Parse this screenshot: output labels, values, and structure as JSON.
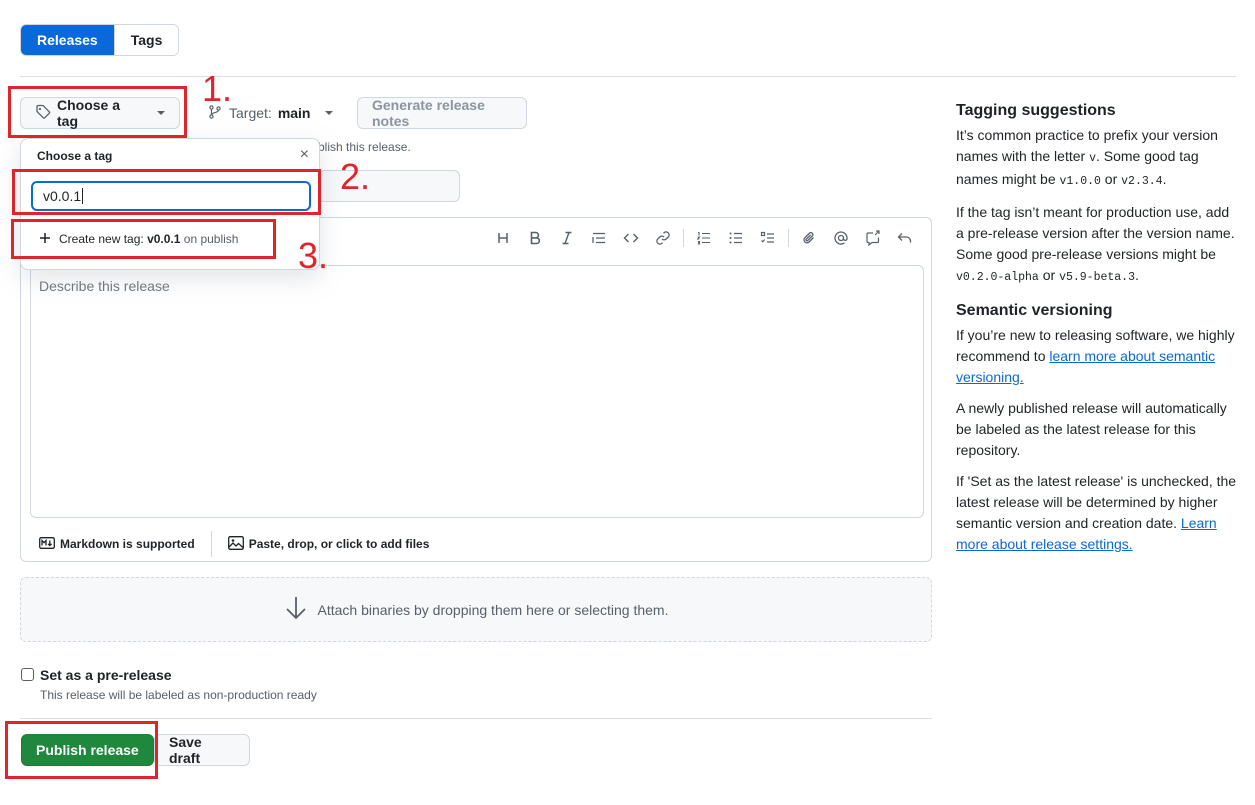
{
  "tabs": [
    {
      "label": "Releases",
      "active": true
    },
    {
      "label": "Tags",
      "active": false
    }
  ],
  "toolbar_row": {
    "choose_tag_label": "Choose a tag",
    "target_prefix": "Target:",
    "target_value": "main",
    "generate_notes_label": "Generate release notes",
    "hint_fragment": "blish this release."
  },
  "tag_popover": {
    "title": "Choose a tag",
    "close_glyph": "×",
    "input_value": "v0.0.1",
    "create_prefix": "Create new tag: ",
    "create_tag": "v0.0.1",
    "create_suffix": " on publish"
  },
  "editor": {
    "placeholder": "Describe this release",
    "markdown_label": "Markdown is supported",
    "attach_files_label": "Paste, drop, or click to add files",
    "toolbar_icons": [
      "heading-icon",
      "bold-icon",
      "italic-icon",
      "quote-icon",
      "code-icon",
      "link-icon",
      "ordered-list-icon",
      "unordered-list-icon",
      "task-list-icon",
      "attach-icon",
      "mention-icon",
      "reference-icon",
      "undo-icon"
    ]
  },
  "attach_binaries_label": "Attach binaries by dropping them here or selecting them.",
  "prerelease": {
    "label": "Set as a pre-release",
    "description": "This release will be labeled as non-production ready",
    "checked": false
  },
  "actions": {
    "publish_label": "Publish release",
    "save_draft_label": "Save draft"
  },
  "annotations": [
    "1.",
    "2.",
    "3."
  ],
  "sidebar": {
    "tagging_title": "Tagging suggestions",
    "tagging_p1_a": "It’s common practice to prefix your version names with the letter ",
    "tagging_p1_code1": "v",
    "tagging_p1_b": ". Some good tag names might be ",
    "tagging_p1_code2": "v1.0.0",
    "tagging_p1_c": " or ",
    "tagging_p1_code3": "v2.3.4",
    "tagging_p1_d": ".",
    "tagging_p2_a": "If the tag isn’t meant for production use, add a pre-release version after the version name. Some good pre-release versions might be ",
    "tagging_p2_code1": "v0.2.0-alpha",
    "tagging_p2_b": " or ",
    "tagging_p2_code2": "v5.9-beta.3",
    "tagging_p2_c": ".",
    "semver_title": "Semantic versioning",
    "semver_p1_a": "If you’re new to releasing software, we highly recommend to ",
    "semver_p1_link": "learn more about semantic versioning.",
    "semver_p2": "A newly published release will automatically be labeled as the latest release for this repository.",
    "semver_p3_a": "If 'Set as the latest release' is unchecked, the latest release will be determined by higher semantic version and creation date. ",
    "semver_p3_link": "Learn more about release settings."
  },
  "colors": {
    "accent": "#0969da",
    "publish": "#1f883d",
    "annotation_red": "#e0242b"
  }
}
